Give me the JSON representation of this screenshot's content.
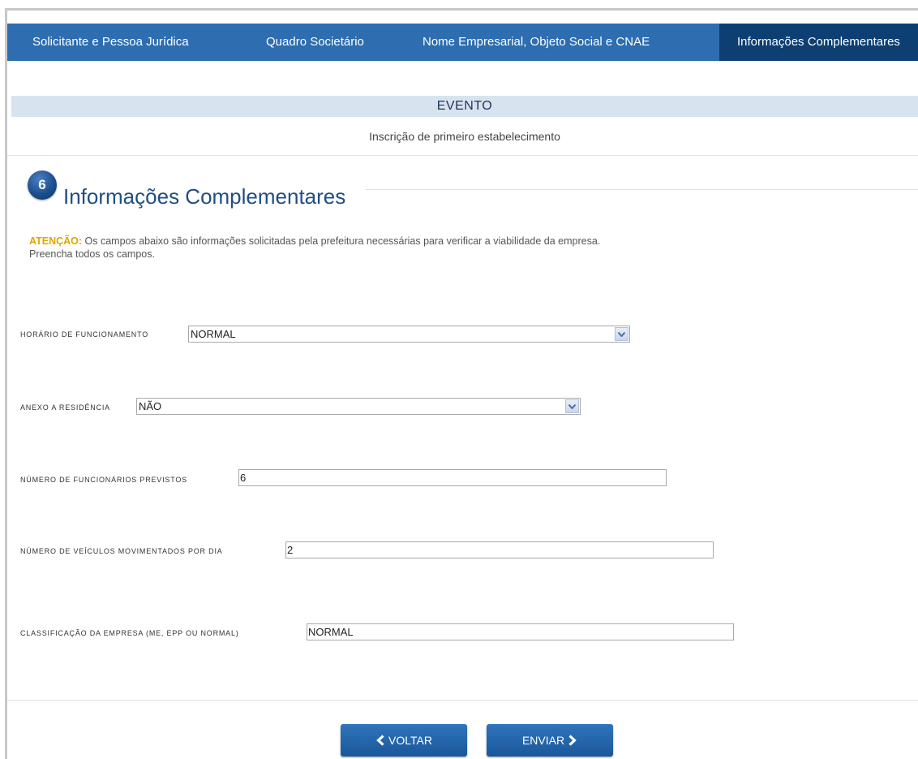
{
  "tabs": [
    {
      "label": "Solicitante e Pessoa Jurídica"
    },
    {
      "label": "Quadro Societário"
    },
    {
      "label": "Nome Empresarial, Objeto Social e CNAE"
    },
    {
      "label": "Informações Complementares"
    }
  ],
  "event": {
    "heading": "EVENTO",
    "description": "Inscrição de primeiro estabelecimento"
  },
  "section": {
    "step_number": "6",
    "title": "Informações Complementares"
  },
  "attention": {
    "label": "ATENÇÃO:",
    "text": " Os campos abaixo são informações solicitadas pela prefeitura necessárias para verificar a viabilidade da empresa.",
    "line2": "Preencha todos os campos."
  },
  "fields": {
    "horario": {
      "label": "Horário de funcionamento",
      "value": "NORMAL"
    },
    "anexo": {
      "label": "Anexo a residência",
      "value": "NÃO"
    },
    "funcionarios": {
      "label": "Número de funcionários previstos",
      "value": "6"
    },
    "veiculos": {
      "label": "Número de veículos movimentados por dia",
      "value": "2"
    },
    "classificacao": {
      "label": "Classificação da empresa (ME, EPP ou NORMAL)",
      "value": "NORMAL"
    }
  },
  "buttons": {
    "back_label": "VOLTAR",
    "send_label": "ENVIAR"
  },
  "icons": {
    "back": "chevron-left-icon",
    "send": "chevron-right-icon",
    "dropdown": "chevron-down-icon"
  },
  "colors": {
    "tab_bar": "#2d6db0",
    "tab_active": "#0d3f73",
    "button": "#1f5fa8",
    "attention": "#e0a400"
  }
}
